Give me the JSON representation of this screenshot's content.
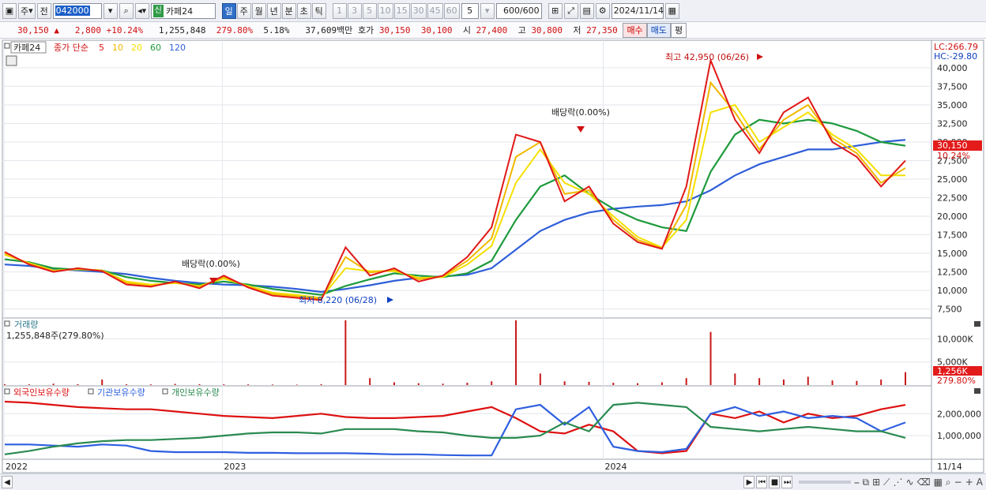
{
  "toolbar": {
    "period_selector": "주",
    "prev_label": "전",
    "code": "042000",
    "new_tag": "신",
    "stock_name": "카페24",
    "period_tabs": [
      "일",
      "주",
      "월",
      "년",
      "분",
      "초",
      "틱"
    ],
    "active_tab": "일",
    "minute_options": [
      "1",
      "3",
      "5",
      "10",
      "15",
      "30",
      "45",
      "60"
    ],
    "interval_value": "5",
    "count_display": "600",
    "count_total": "/600",
    "date": "2024/11/14"
  },
  "quote": {
    "price": "30,150",
    "arrow": "▲",
    "change": "2,800",
    "change_pct": "+10.24%",
    "volume": "1,255,848",
    "volume_ratio": "279.80%",
    "turnover_rate": "5.18%",
    "trade_value": "37,609백만",
    "bid_label": "호가",
    "ask_price": "30,150",
    "bid_price": "30,100",
    "open_label": "시",
    "open": "27,400",
    "high_label": "고",
    "high": "30,800",
    "low_label": "저",
    "low": "27,350",
    "buy_label": "매수",
    "sell_label": "매도",
    "eval_label": "평"
  },
  "price_panel": {
    "stock_tag": "카페24",
    "legend_title": "종가 단순",
    "ma_periods": [
      "5",
      "10",
      "20",
      "60",
      "120"
    ],
    "ma_colors": [
      "#e01818",
      "#f0b800",
      "#f5e000",
      "#1e9a3c",
      "#2f5fd8"
    ],
    "lc_label": "LC:266.79",
    "hc_label": "HC:-29.80",
    "annotations": {
      "high": "최고 42,950 (06/26)",
      "low": "최저 8,220 (06/28)",
      "dividend1": "배당락(0.00%)",
      "dividend2": "배당락(0.00%)"
    },
    "current_price_label": "30,150",
    "current_pct_label": "10.24%"
  },
  "volume_panel": {
    "title": "거래량",
    "value_label": "1,255,848주(279.80%)",
    "current_label": "1,256K",
    "current_pct": "279.80%"
  },
  "holdings_panel": {
    "series_labels": [
      "외국인보유수량",
      "기관보유수량",
      "개인보유수량"
    ],
    "series_colors": [
      "#dd1111",
      "#2e5fe0",
      "#2a8a50"
    ]
  },
  "x_axis": {
    "labels": [
      "2022",
      "2023",
      "2024"
    ],
    "end_label": "11/14"
  },
  "chart_data": [
    {
      "type": "line",
      "title": "카페24 종가 단순",
      "y_ticks": [
        "40,000",
        "37,500",
        "35,000",
        "32,500",
        "30,000",
        "27,500",
        "25,000",
        "22,500",
        "20,000",
        "17,500",
        "15,000",
        "12,500",
        "10,000",
        "7,500"
      ],
      "ylim": [
        6500,
        43500
      ],
      "x_ticks": [
        "2022",
        "2023",
        "2024"
      ],
      "series": [
        {
          "name": "5",
          "values": [
            15200,
            13500,
            12500,
            13000,
            12600,
            10800,
            10500,
            11200,
            10300,
            12000,
            10400,
            9300,
            9000,
            8700,
            15800,
            12000,
            13000,
            11200,
            12000,
            14500,
            18500,
            31000,
            30000,
            22000,
            24000,
            19000,
            16500,
            15600,
            24000,
            41000,
            33000,
            28500,
            34000,
            36000,
            30000,
            28000,
            24000,
            27500
          ]
        },
        {
          "name": "10",
          "values": [
            15000,
            13600,
            12600,
            12900,
            12700,
            11000,
            10600,
            11100,
            10500,
            11800,
            10500,
            9500,
            9200,
            8900,
            14500,
            12400,
            12800,
            11500,
            11900,
            14000,
            17000,
            28000,
            30000,
            23000,
            23500,
            19500,
            16800,
            15700,
            21500,
            38000,
            34000,
            29000,
            33000,
            35000,
            30500,
            28500,
            24500,
            26500
          ]
        },
        {
          "name": "20",
          "values": [
            14800,
            13700,
            12700,
            12850,
            12700,
            11200,
            10800,
            11000,
            10600,
            11600,
            10600,
            9700,
            9400,
            9000,
            13000,
            12600,
            12600,
            11700,
            11800,
            13500,
            16000,
            24500,
            29000,
            24500,
            23000,
            20000,
            17200,
            15800,
            19500,
            34000,
            35000,
            30000,
            32000,
            34000,
            31000,
            29000,
            25500,
            25500
          ]
        },
        {
          "name": "60",
          "values": [
            14200,
            13800,
            13000,
            12800,
            12700,
            11800,
            11300,
            11000,
            10800,
            11200,
            10800,
            10200,
            9800,
            9400,
            10600,
            11500,
            12300,
            12000,
            11800,
            12300,
            14000,
            19500,
            24000,
            25500,
            23000,
            21000,
            19500,
            18500,
            18000,
            26000,
            31000,
            33000,
            32500,
            33000,
            32500,
            31500,
            30000,
            29500
          ]
        },
        {
          "name": "120",
          "values": [
            13500,
            13300,
            12900,
            12700,
            12500,
            12200,
            11700,
            11300,
            11000,
            10800,
            10700,
            10500,
            10200,
            9800,
            10200,
            10700,
            11300,
            11700,
            11900,
            12100,
            13000,
            15500,
            18000,
            19500,
            20500,
            21000,
            21300,
            21500,
            22000,
            23500,
            25500,
            27000,
            28000,
            29000,
            29000,
            29500,
            30000,
            30300
          ]
        }
      ]
    },
    {
      "type": "bar",
      "title": "거래량",
      "y_ticks": [
        "10,000K",
        "5,000K"
      ],
      "ylim": [
        0,
        14000
      ],
      "unit": "K",
      "values": [
        200,
        150,
        300,
        200,
        1200,
        180,
        150,
        250,
        200,
        160,
        150,
        120,
        100,
        200,
        14500,
        1500,
        600,
        400,
        300,
        500,
        800,
        16500,
        2500,
        800,
        700,
        500,
        400,
        600,
        1500,
        11500,
        2500,
        1500,
        1200,
        1800,
        1000,
        900,
        1200,
        2800
      ]
    },
    {
      "type": "line",
      "title": "보유수량",
      "y_ticks": [
        "2,000,000",
        "1,000,000"
      ],
      "ylim": [
        0,
        2800000
      ],
      "series": [
        {
          "name": "외국인보유수량",
          "values": [
            2550000,
            2500000,
            2400000,
            2300000,
            2250000,
            2200000,
            2200000,
            2100000,
            2000000,
            1900000,
            1850000,
            1800000,
            1900000,
            2000000,
            1850000,
            1800000,
            1800000,
            1850000,
            1900000,
            2100000,
            2300000,
            1800000,
            1200000,
            1100000,
            1500000,
            1200000,
            300000,
            200000,
            300000,
            2000000,
            1800000,
            2100000,
            1600000,
            2000000,
            1800000,
            1900000,
            2200000,
            2400000
          ]
        },
        {
          "name": "기관보유수량",
          "values": [
            600000,
            600000,
            550000,
            500000,
            600000,
            550000,
            300000,
            250000,
            250000,
            250000,
            220000,
            220000,
            200000,
            200000,
            200000,
            180000,
            150000,
            150000,
            120000,
            100000,
            100000,
            2200000,
            2400000,
            1500000,
            2300000,
            500000,
            300000,
            250000,
            400000,
            2000000,
            2300000,
            1900000,
            2100000,
            1800000,
            1900000,
            1800000,
            1200000,
            1600000
          ]
        },
        {
          "name": "개인보유수량",
          "values": [
            150000,
            300000,
            500000,
            650000,
            750000,
            800000,
            800000,
            850000,
            900000,
            1000000,
            1100000,
            1150000,
            1150000,
            1100000,
            1300000,
            1300000,
            1300000,
            1200000,
            1150000,
            1000000,
            900000,
            900000,
            1000000,
            1600000,
            1200000,
            2400000,
            2500000,
            2400000,
            2300000,
            1400000,
            1300000,
            1200000,
            1300000,
            1400000,
            1300000,
            1200000,
            1200000,
            900000
          ]
        }
      ]
    }
  ]
}
